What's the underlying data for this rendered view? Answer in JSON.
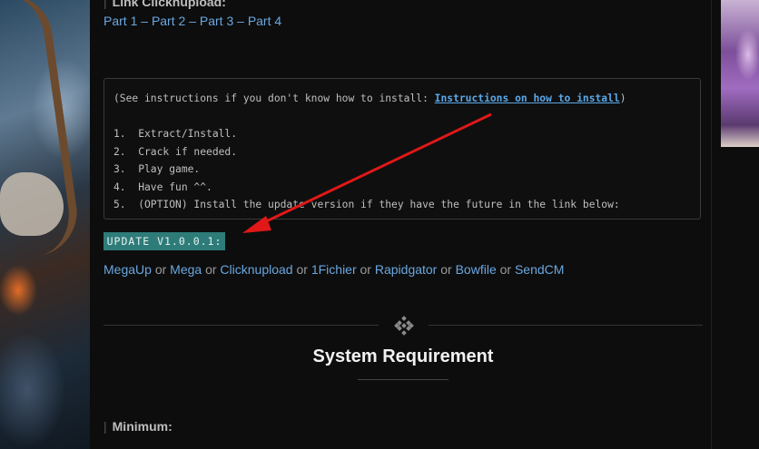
{
  "previous_section": {
    "heading": "Link Clicknupload:",
    "parts": [
      "Part 1",
      "Part 2",
      "Part 3",
      "Part 4"
    ],
    "separator": "–"
  },
  "instructions": {
    "prefix": "(See instructions if you don't know how to install: ",
    "link_label": "Instructions on how to install",
    "suffix": ")",
    "steps": [
      "1.  Extract/Install.",
      "2.  Crack if needed.",
      "3.  Play game.",
      "4.  Have fun ^^.",
      "5.  (OPTION) Install the update version if they have the future in the link below:"
    ]
  },
  "update": {
    "label": "UPDATE V1.0.0.1:"
  },
  "mirrors": {
    "links": [
      "MegaUp",
      "Mega",
      "Clicknupload",
      "1Fichier",
      "Rapidgator",
      "Bowfile",
      "SendCM"
    ],
    "joiner": "or"
  },
  "system_requirement": {
    "title": "System Requirement",
    "divider_icon": "diamond-dots-icon"
  },
  "minimum": {
    "heading": "Minimum:"
  },
  "colors": {
    "link": "#6aa7e0",
    "update_bg": "#2e7c79",
    "arrow": "#e01818",
    "background": "#0d0d0d"
  }
}
